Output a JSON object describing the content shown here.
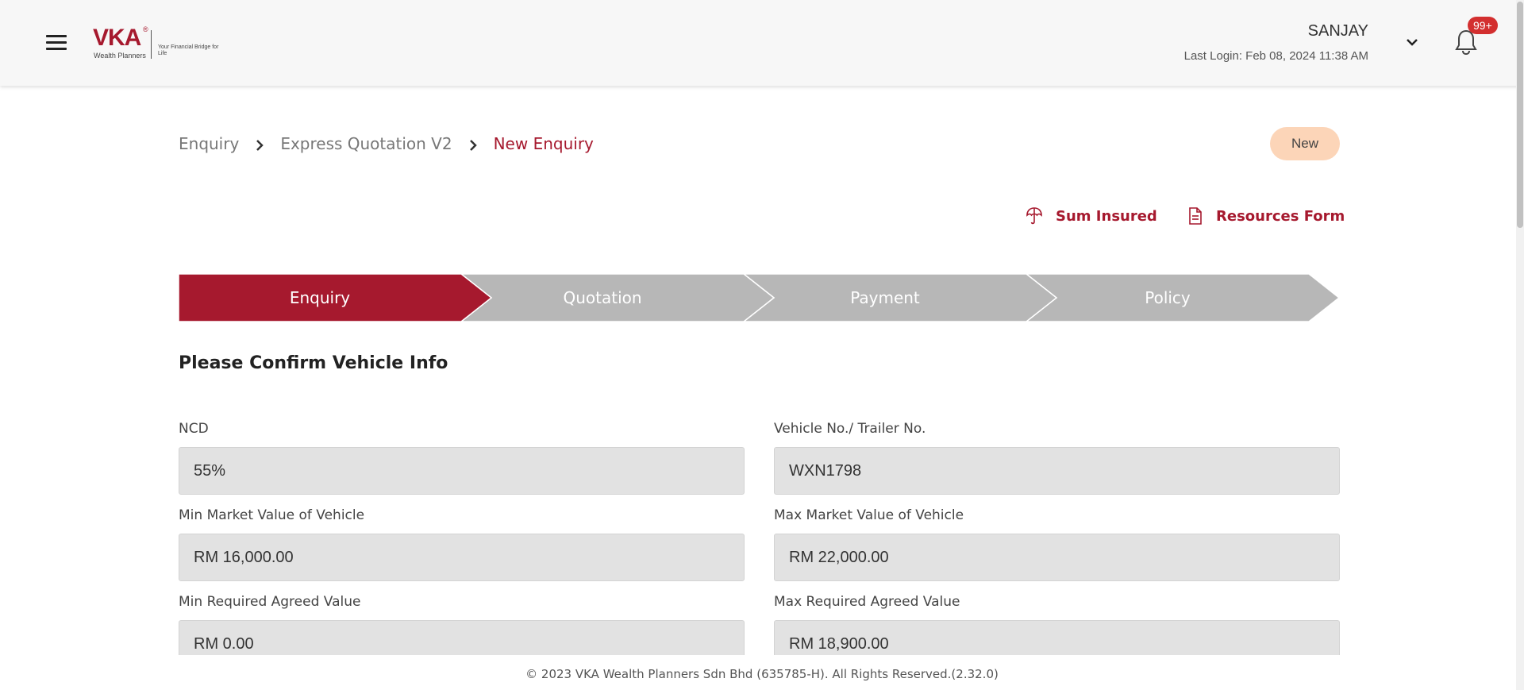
{
  "header": {
    "logo_text": "VKA",
    "logo_registered": "®",
    "logo_subtitle": "Wealth Planners",
    "logo_tagline": "Your Financial Bridge for Life",
    "user_name": "SANJAY",
    "last_login": "Last Login: Feb 08, 2024 11:38 AM",
    "notification_count": "99+"
  },
  "breadcrumb": {
    "items": [
      "Enquiry",
      "Express Quotation V2",
      "New Enquiry"
    ]
  },
  "status": {
    "label": "New",
    "color": "#fcd5b8"
  },
  "actions": {
    "sum_insured": "Sum Insured",
    "resources_form": "Resources Form"
  },
  "stepper": {
    "steps": [
      "Enquiry",
      "Quotation",
      "Payment",
      "Policy"
    ],
    "active_index": 0,
    "active_color": "#a6192e",
    "inactive_color": "#b7b7b7"
  },
  "form": {
    "title": "Please Confirm Vehicle Info",
    "fields": {
      "ncd": {
        "label": "NCD",
        "value": "55%"
      },
      "vehicle_no": {
        "label": "Vehicle No./ Trailer No.",
        "value": "WXN1798"
      },
      "min_market": {
        "label": "Min Market Value of Vehicle",
        "value": "RM 16,000.00"
      },
      "max_market": {
        "label": "Max Market Value of Vehicle",
        "value": "RM 22,000.00"
      },
      "min_agreed": {
        "label": "Min Required Agreed Value",
        "value": "RM 0.00"
      },
      "max_agreed": {
        "label": "Max Required Agreed Value",
        "value": "RM 18,900.00"
      }
    }
  },
  "footer": {
    "text": "© 2023 VKA Wealth Planners Sdn Bhd (635785-H). All Rights Reserved.(2.32.0)"
  },
  "icons": {
    "menu": "hamburger-menu-icon",
    "chevron": "chevron-down-icon",
    "bell": "bell-icon",
    "crumb_sep": "chevron-right-icon",
    "sum_insured": "umbrella-icon",
    "resources_form": "document-icon"
  }
}
